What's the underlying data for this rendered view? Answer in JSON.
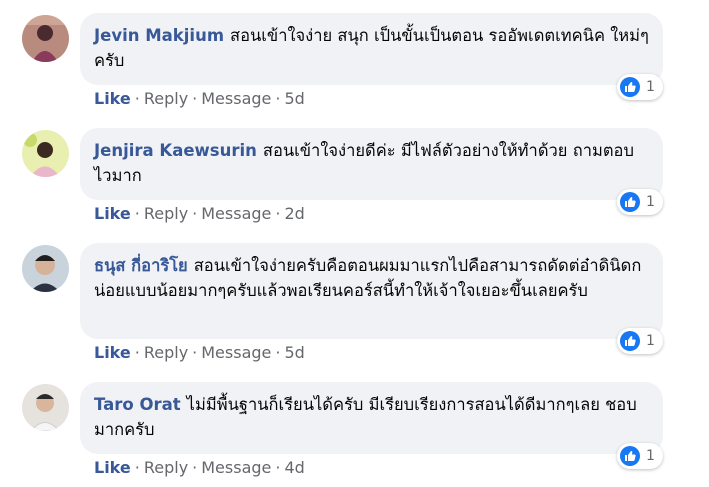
{
  "comments": [
    {
      "author": "Jevin Makjium",
      "text": "สอนเข้าใจง่าย สนุก เป็นขั้นเป็นตอน รออัพเดตเทคนิค ใหม่ๆครับ",
      "reactions": "1",
      "like": "Like",
      "reply": "Reply",
      "message": "Message",
      "time": "5d",
      "avatar_color": "#7a4a5a"
    },
    {
      "author": "Jenjira Kaewsurin",
      "text": "สอนเข้าใจง่ายดีค่ะ มีไฟล์ตัวอย่างให้ทำด้วย ถามตอบไวมาก",
      "reactions": "1",
      "like": "Like",
      "reply": "Reply",
      "message": "Message",
      "time": "2d",
      "avatar_color": "#c9d66a"
    },
    {
      "author": "ธนุส กี่อาริโย",
      "text": "สอนเข้าใจง่ายครับคือตอนผมมาแรกไปคือสามารถดัดต่อ๋าดินิดกน่อยแบบน้อยมากๆครับแล้วพอเรียนคอร์สนี้ทำให้เจ้าใจเยอะขึ้นเลยครับ",
      "reactions": "1",
      "like": "Like",
      "reply": "Reply",
      "message": "Message",
      "time": "5d",
      "avatar_color": "#5a6b7a"
    },
    {
      "author": "Taro Orat",
      "text": "ไม่มีพื้นฐานก็เรียนได้ครับ มีเรียบเรียงการสอนได้ดีมากๆเลย ชอบมากครับ",
      "reactions": "1",
      "like": "Like",
      "reply": "Reply",
      "message": "Message",
      "time": "4d",
      "avatar_color": "#d8d4cf"
    }
  ],
  "colors": {
    "author": "#385898",
    "bubble": "#f0f2f5",
    "meta": "#65676b",
    "like_badge": "#1877f2"
  },
  "icons": {
    "reaction": "thumbs-up-icon"
  }
}
